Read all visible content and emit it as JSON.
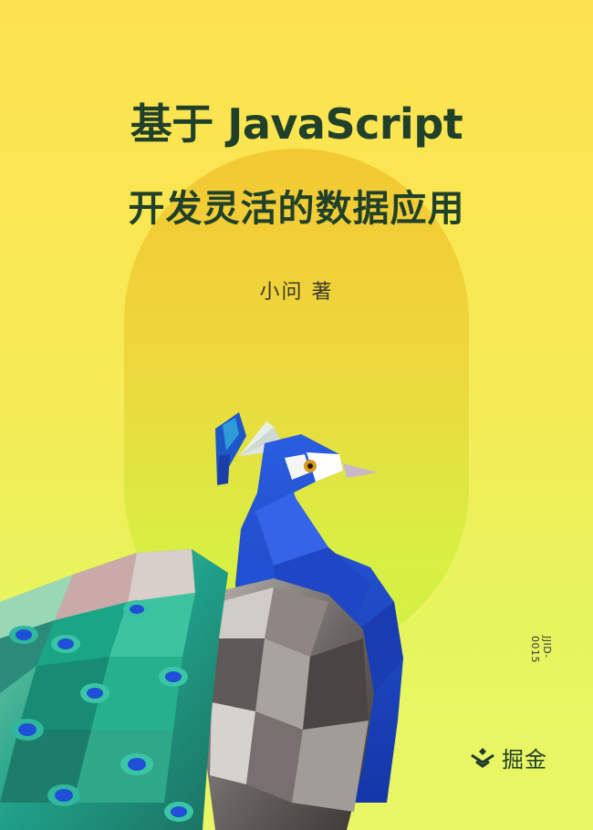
{
  "cover": {
    "title_line1": "基于 JavaScript",
    "title_line2": "开发灵活的数据应用",
    "author": "小问 著",
    "serial": "JJID-0015",
    "brand": "掘金"
  },
  "icons": [
    "juejin-logo-icon"
  ],
  "colors": {
    "title": "#21402a",
    "peacock_blue": "#1f4fd6",
    "background_top": "#fde24f",
    "background_bottom": "#e9f767"
  }
}
